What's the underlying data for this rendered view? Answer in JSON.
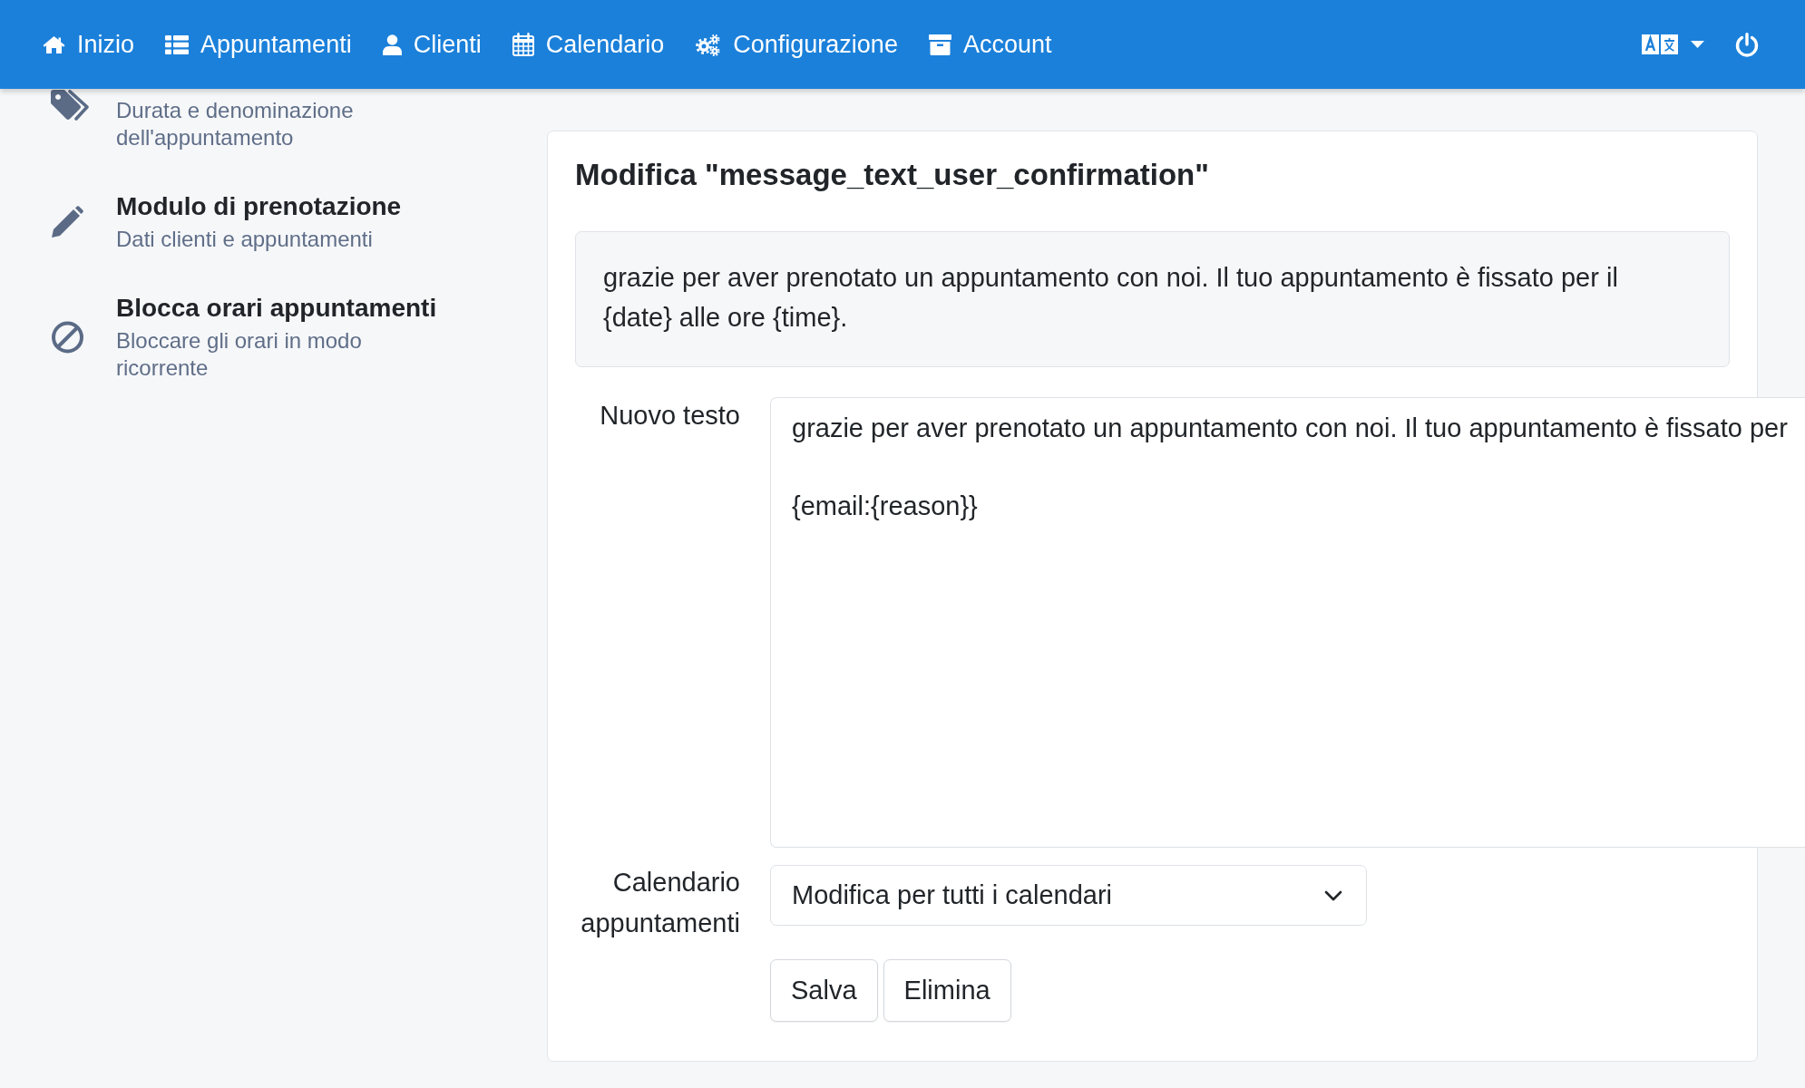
{
  "navbar": {
    "links": [
      {
        "label": "Inizio"
      },
      {
        "label": "Appuntamenti"
      },
      {
        "label": "Clienti"
      },
      {
        "label": "Calendario"
      },
      {
        "label": "Configurazione"
      },
      {
        "label": "Account"
      }
    ]
  },
  "sidebar": {
    "items": [
      {
        "description": "Durata e denominazione dell'appuntamento"
      },
      {
        "title": "Modulo di prenotazione",
        "description": "Dati clienti e appuntamenti"
      },
      {
        "title": "Blocca orari appuntamenti",
        "description": "Bloccare gli orari in modo ricorrente"
      }
    ]
  },
  "card": {
    "title": "Modifica \"message_text_user_confirmation\"",
    "current_text": "grazie per aver prenotato un appuntamento con noi. Il tuo appuntamento è fissato per il {date} alle ore {time}.",
    "fields": [
      {
        "kind": "textarea",
        "label": "Nuovo testo",
        "value": "grazie per aver prenotato un appuntamento con noi. Il tuo appuntamento è fissato per\n\n{email:{reason}}"
      },
      {
        "kind": "select",
        "label": "Calendario appuntamenti",
        "value": "Modifica per tutti i calendari"
      }
    ],
    "buttons": [
      {
        "label": "Salva"
      },
      {
        "label": "Elimina"
      }
    ]
  }
}
